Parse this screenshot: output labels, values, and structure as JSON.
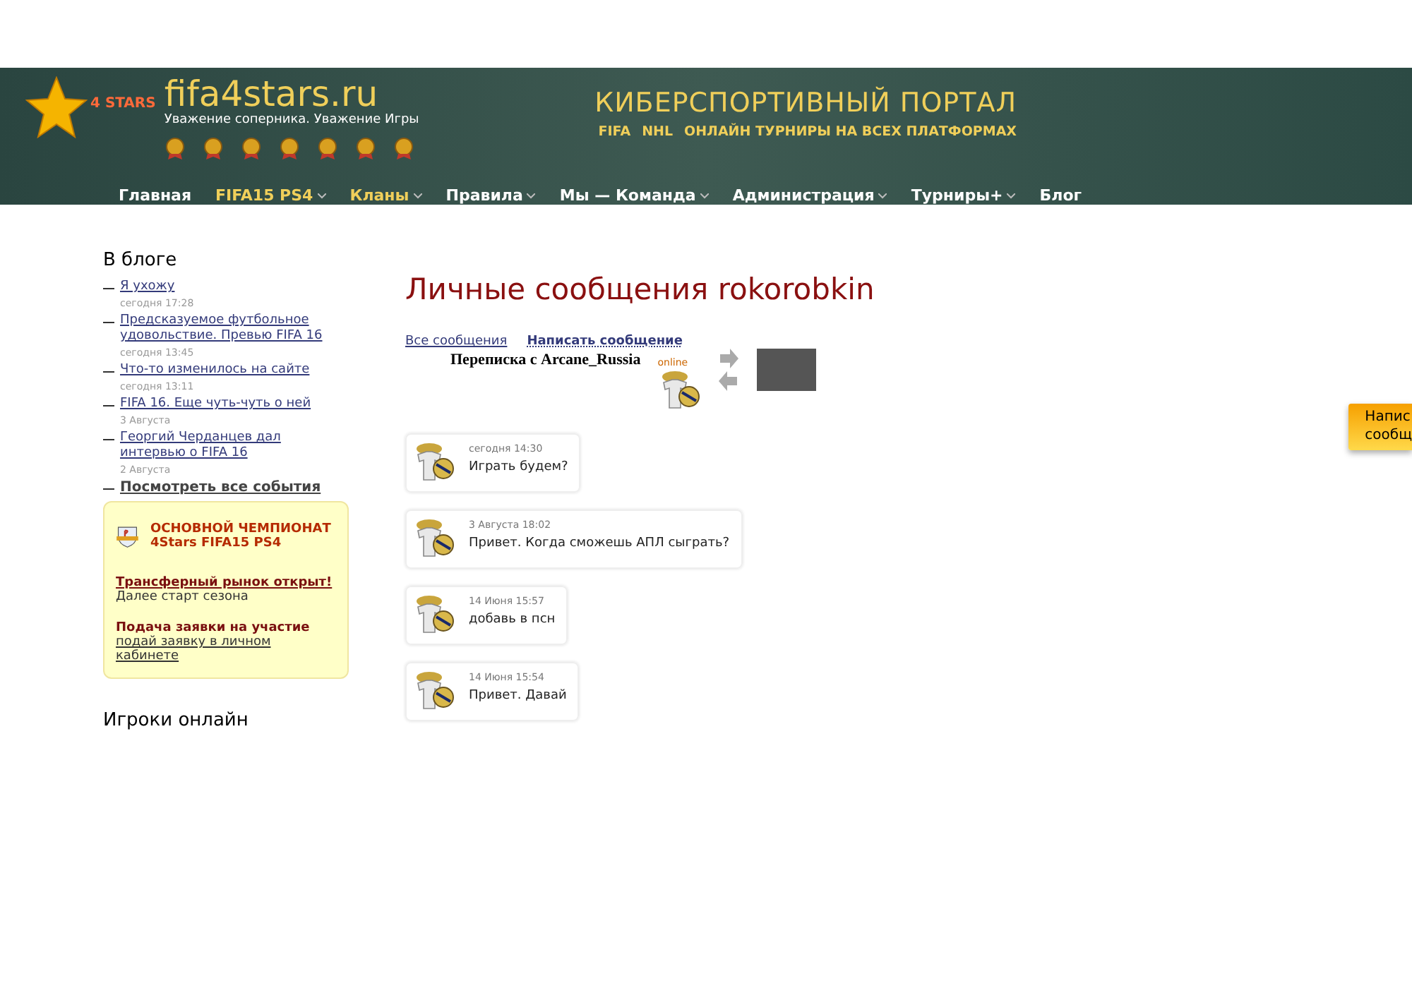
{
  "header": {
    "logo_badge": "4 STARS",
    "site_name": "fifa4stars.ru",
    "slogan": "Уважение соперника. Уважение Игры",
    "portal_title": "КИБЕРСПОРТИВНЫЙ ПОРТАЛ",
    "portal_tags": [
      "FIFA",
      "NHL"
    ],
    "portal_subtitle": "ОНЛАЙН ТУРНИРЫ НА ВСЕХ ПЛАТФОРМАХ"
  },
  "nav": [
    {
      "label": "Главная",
      "selected": false,
      "has_menu": false
    },
    {
      "label": "FIFA15 PS4",
      "selected": true,
      "has_menu": true
    },
    {
      "label": "Кланы",
      "selected": true,
      "has_menu": true
    },
    {
      "label": "Правила",
      "selected": false,
      "has_menu": true
    },
    {
      "label": "Мы — Команда",
      "selected": false,
      "has_menu": true
    },
    {
      "label": "Администрация",
      "selected": false,
      "has_menu": true
    },
    {
      "label": "Турниры+",
      "selected": false,
      "has_menu": true
    },
    {
      "label": "Блог",
      "selected": false,
      "has_menu": false
    }
  ],
  "sidebar": {
    "blog_title": "В блоге",
    "blog_items": [
      {
        "title": "Я ухожу",
        "time": "сегодня 17:28"
      },
      {
        "title": "Предсказуемое футбольное удовольствие. Превью FIFA 16",
        "time": "сегодня 13:45"
      },
      {
        "title": "Что-то изменилось на сайте",
        "time": "сегодня 13:11"
      },
      {
        "title": "FIFA 16. Еще чуть-чуть о ней",
        "time": "3 Августа"
      },
      {
        "title": "Георгий Черданцев дал интервью о FIFA 16",
        "time": "2 Августа"
      }
    ],
    "all_events": "Посмотреть все события",
    "promo": {
      "title": "ОСНОВНОЙ ЧЕМПИОНАТ 4Stars FIFA15 PS4",
      "link1": "Трансферный рынок открыт!",
      "text1": "Далее старт сезона",
      "heading2": "Подача заявки на участие",
      "link2": "подай заявку в личном кабинете"
    },
    "online_title": "Игроки онлайн"
  },
  "main": {
    "title": "Личные сообщения rokorobkin",
    "tabs": [
      {
        "label": "Все сообщения",
        "selected": false
      },
      {
        "label": "Написать сообщение",
        "selected": true
      }
    ],
    "conversation": "Переписка с Arcane_Russia",
    "online_badge": "online",
    "messages": [
      {
        "time": "сегодня 14:30",
        "text": "Играть будем?"
      },
      {
        "time": "3 Августа 18:02",
        "text": "Привет. Когда сможешь АПЛ сыграть?"
      },
      {
        "time": "14 Июня 15:57",
        "text": "добавь в псн"
      },
      {
        "time": "14 Июня 15:54",
        "text": "Привет. Давай"
      }
    ]
  },
  "side_tab": [
    "Напис",
    "сообщ"
  ]
}
